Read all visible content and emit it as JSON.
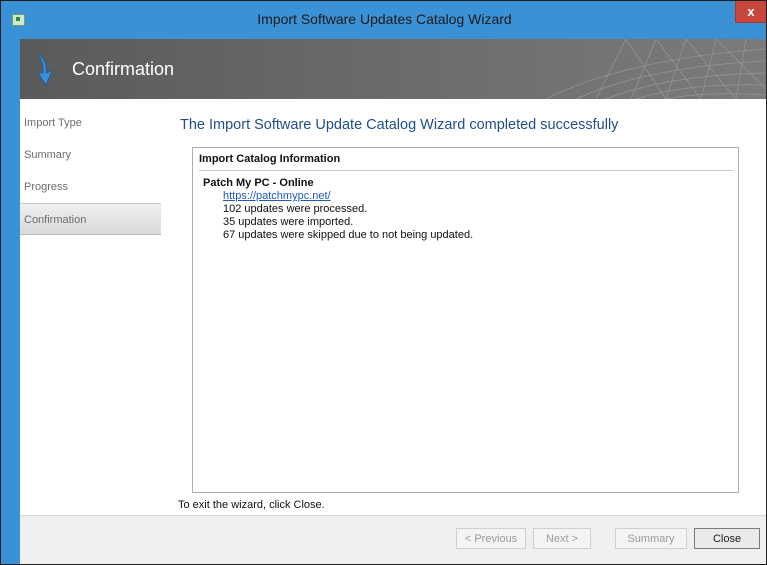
{
  "window": {
    "title": "Import Software Updates Catalog Wizard",
    "close_glyph": "x"
  },
  "banner": {
    "title": "Confirmation",
    "icon": "wizard-arrow-icon"
  },
  "nav": {
    "items": [
      {
        "label": "Import Type",
        "active": false
      },
      {
        "label": "Summary",
        "active": false
      },
      {
        "label": "Progress",
        "active": false
      },
      {
        "label": "Confirmation",
        "active": true
      }
    ]
  },
  "main": {
    "headline": "The Import Software Update Catalog Wizard completed successfully",
    "info_header": "Import Catalog Information",
    "catalog": {
      "name": "Patch My PC - Online",
      "link": "https://patchmypc.net/",
      "lines": [
        "102 updates were processed.",
        "35 updates were imported.",
        "67 updates were skipped due to not being updated."
      ]
    },
    "exit_hint": "To exit the wizard, click Close."
  },
  "footer": {
    "previous_label": "< Previous",
    "next_label": "Next >",
    "summary_label": "Summary",
    "close_label": "Close"
  },
  "colors": {
    "titlebar": "#3b91d6",
    "banner": "#6b6b6b",
    "headline": "#1f4e8c",
    "link": "#1f5ab8",
    "close_button": "#c9463d"
  }
}
